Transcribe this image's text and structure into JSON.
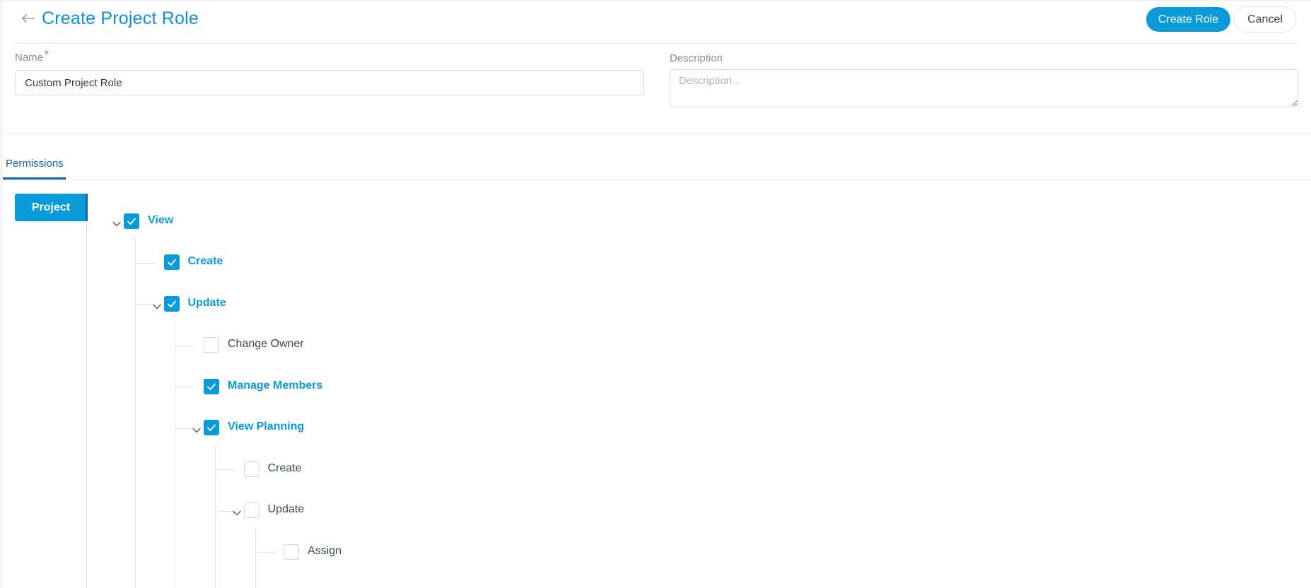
{
  "header": {
    "title": "Create Project Role",
    "create_button": "Create Role",
    "cancel_button": "Cancel"
  },
  "form": {
    "name": {
      "label": "Name",
      "required_mark": "*",
      "value": "Custom Project Role"
    },
    "description": {
      "label": "Description",
      "placeholder": "Description...",
      "value": ""
    }
  },
  "tabs": [
    {
      "label": "Permissions",
      "active": true
    }
  ],
  "sidebar": {
    "items": [
      {
        "label": "Project",
        "active": true
      }
    ]
  },
  "tree": [
    {
      "label": "View",
      "checked": true
    },
    {
      "label": "Create",
      "checked": true
    },
    {
      "label": "Update",
      "checked": true
    },
    {
      "label": "Change Owner",
      "checked": false
    },
    {
      "label": "Manage Members",
      "checked": true
    },
    {
      "label": "View Planning",
      "checked": true
    },
    {
      "label": "Create",
      "checked": false
    },
    {
      "label": "Update",
      "checked": false
    },
    {
      "label": "Assign",
      "checked": false
    }
  ],
  "colors": {
    "accent": "#099ad9",
    "title": "#0f8ed4",
    "tab_active": "#1a63a8",
    "required": "#e53935"
  },
  "icons": {
    "back": "arrow-left-icon",
    "expand": "chevron-down-icon",
    "check": "check-icon"
  }
}
